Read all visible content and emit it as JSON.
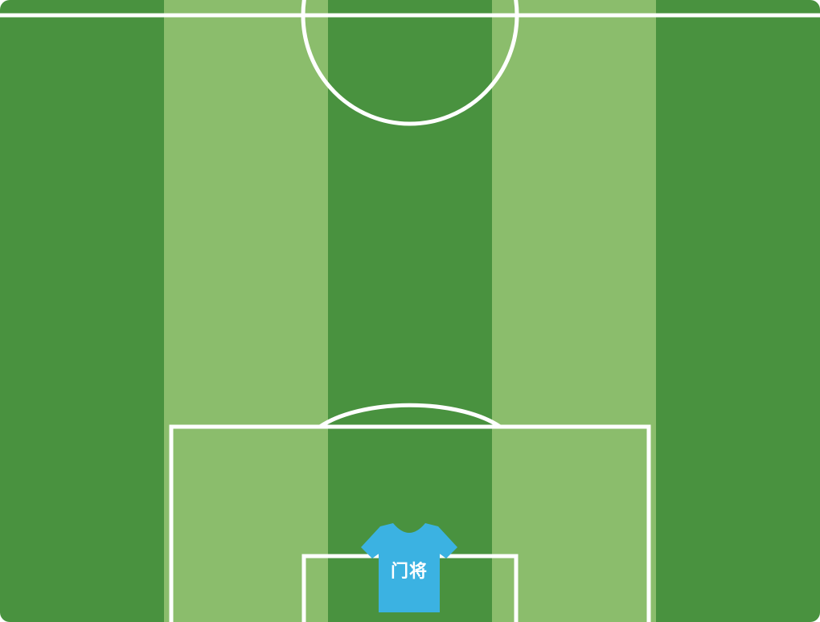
{
  "pitch": {
    "colors": {
      "dark_stripe": "#49923f",
      "light_stripe": "#8bbd6c",
      "line": "#ffffff"
    }
  },
  "players": [
    {
      "position_label": "门将",
      "shirt_color": "#3bb2e2",
      "icon": "shirt-icon"
    }
  ]
}
